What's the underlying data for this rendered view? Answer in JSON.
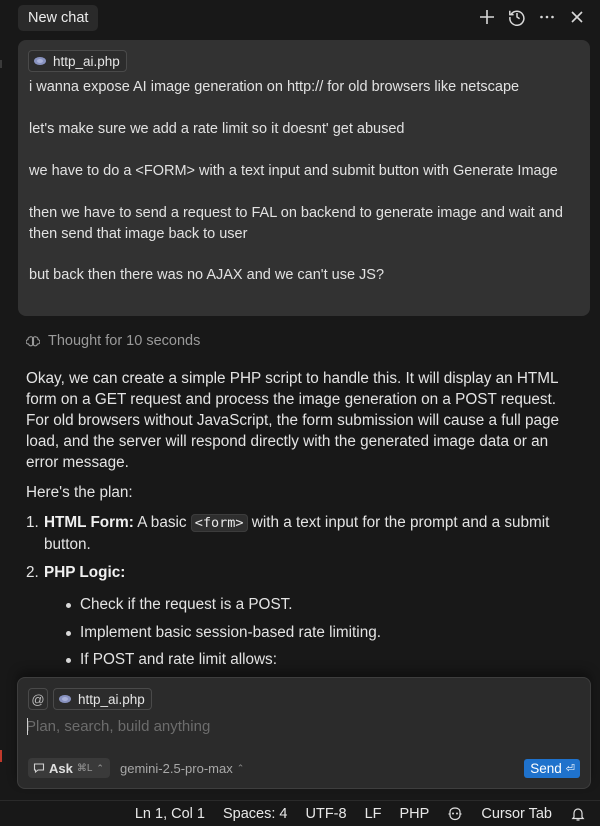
{
  "header": {
    "title": "New chat",
    "icons": [
      "plus-icon",
      "history-icon",
      "more-icon",
      "close-icon"
    ]
  },
  "user_message": {
    "file_chip": "http_ai.php",
    "lines": [
      "i wanna expose AI image generation on http:// for old browsers like netscape",
      "let's make sure we add a rate limit so it doesnt' get abused",
      "we have to do a <FORM> with a text input and submit button with Generate Image",
      "then we have to send a request to FAL on backend to generate image and wait and",
      "then send that image back to user",
      "but back then there was no AJAX and we can't use JS?"
    ]
  },
  "thought": {
    "label": "Thought for 10 seconds"
  },
  "assistant": {
    "intro": "Okay, we can create a simple PHP script to handle this. It will display an HTML form on a GET request and process the image generation on a POST request. For old browsers without JavaScript, the form submission will cause a full page load, and the server will respond directly with the generated image data or an error message.",
    "plan_heading": "Here's the plan:",
    "steps": [
      {
        "num": "1.",
        "title": "HTML Form:",
        "pre": " A basic ",
        "code": "<form>",
        "post": " with a text input for the prompt and a submit button."
      },
      {
        "num": "2.",
        "title": "PHP Logic:"
      }
    ],
    "bullets": [
      "Check if the request is a POST.",
      "Implement basic session-based rate limiting.",
      "If POST and rate limit allows:"
    ]
  },
  "composer": {
    "at_label": "@",
    "file_chip": "http_ai.php",
    "placeholder": "Plan, search, build anything",
    "mode_label": "Ask",
    "mode_shortcut": "⌘L",
    "model": "gemini-2.5-pro-max",
    "send_label": "Send"
  },
  "status_bar": {
    "position": "Ln 1, Col 1",
    "spaces": "Spaces: 4",
    "encoding": "UTF-8",
    "eol": "LF",
    "language": "PHP",
    "cursor_tab": "Cursor Tab"
  }
}
